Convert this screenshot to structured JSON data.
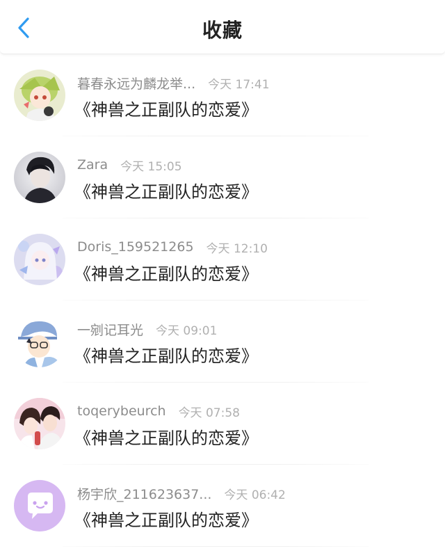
{
  "header": {
    "title": "收藏"
  },
  "items": [
    {
      "username": "暮春永远为麟龙举...",
      "time": "今天 17:41",
      "content": "《神兽之正副队的恋爱》"
    },
    {
      "username": "Zara",
      "time": "今天 15:05",
      "content": "《神兽之正副队的恋爱》"
    },
    {
      "username": "Doris_159521265",
      "time": "今天 12:10",
      "content": "《神兽之正副队的恋爱》"
    },
    {
      "username": "一剜记耳光",
      "time": "今天 09:01",
      "content": "《神兽之正副队的恋爱》"
    },
    {
      "username": "toqerybeurch",
      "time": "今天 07:58",
      "content": "《神兽之正副队的恋爱》"
    },
    {
      "username": "杨宇欣_211623637...",
      "time": "今天 06:42",
      "content": "《神兽之正副队的恋爱》"
    }
  ],
  "colors": {
    "accent": "#2f9bf0",
    "username": "#8c8c8c",
    "time": "#b0b0b0",
    "content": "#222222",
    "default_avatar": "#d6b8f2"
  }
}
